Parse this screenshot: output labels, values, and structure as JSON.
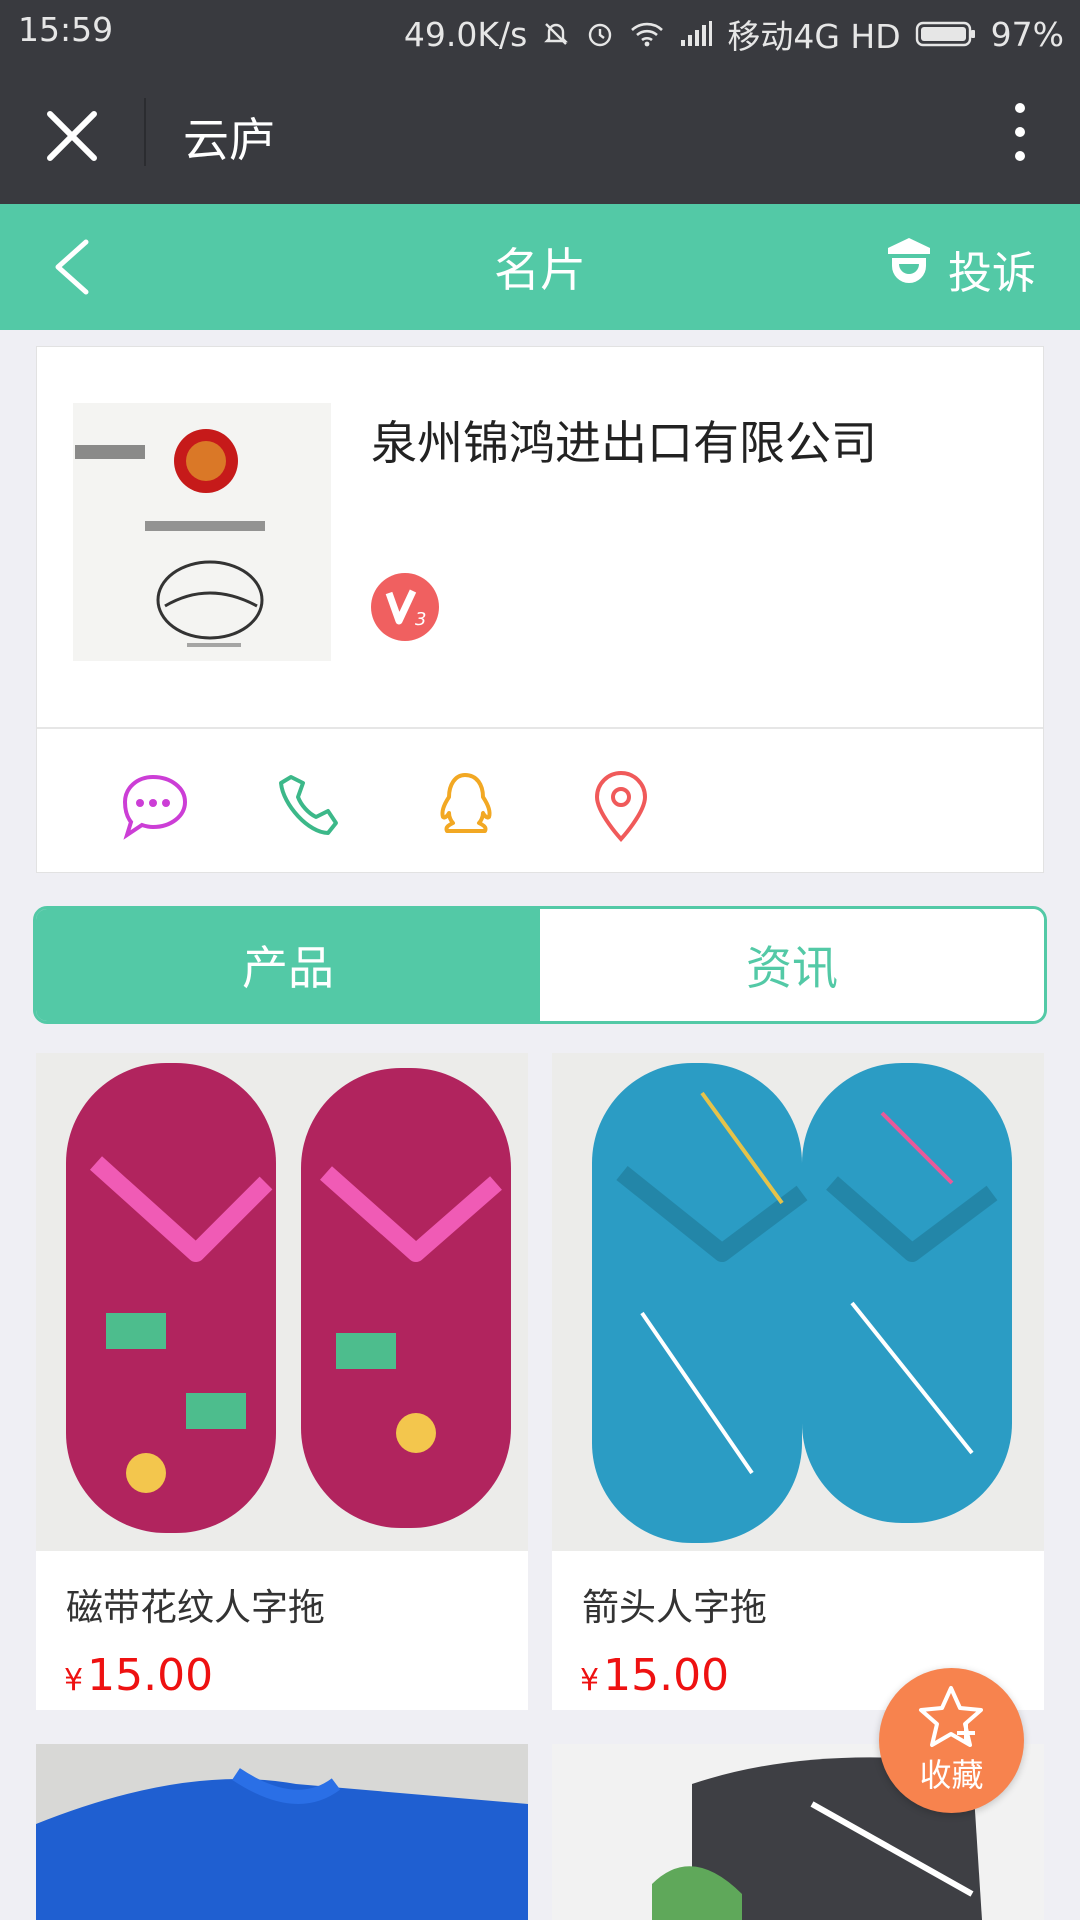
{
  "status_bar": {
    "time": "15:59",
    "speed": "49.0K/s",
    "carrier": "移动4G HD",
    "battery": "97%"
  },
  "wechat_bar": {
    "title": "云庐"
  },
  "nav": {
    "title": "名片",
    "complain_label": "投诉"
  },
  "company": {
    "name": "泉州锦鸿进出口有限公司",
    "level_badge": "V3"
  },
  "contact_actions": [
    "message-icon",
    "phone-icon",
    "qq-icon",
    "location-pin-icon"
  ],
  "tabs": [
    {
      "label": "产品",
      "active": true
    },
    {
      "label": "资讯",
      "active": false
    }
  ],
  "products": [
    {
      "name": "磁带花纹人字拖",
      "currency": "¥",
      "price": "15.00",
      "color": "#b1245e"
    },
    {
      "name": "箭头人字拖",
      "currency": "¥",
      "price": "15.00",
      "color": "#2b9cc4"
    },
    {
      "color": "#1f5fd1"
    },
    {
      "color": "#3e3f44"
    }
  ],
  "favorite": {
    "label": "收藏"
  },
  "colors": {
    "accent": "#53c9a6",
    "price": "#ee1111",
    "favorite": "#f7834e",
    "topbar": "#393a3f"
  }
}
